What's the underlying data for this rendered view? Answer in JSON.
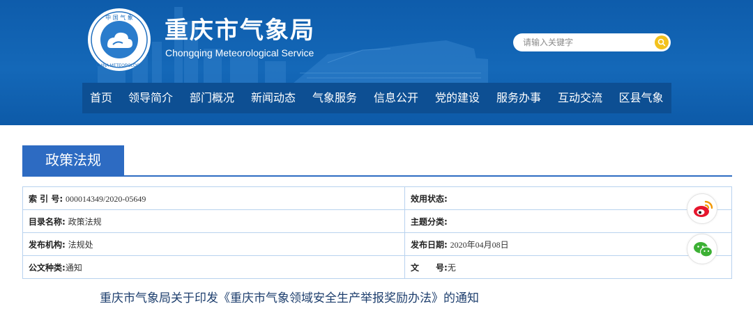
{
  "header": {
    "title": "重庆市气象局",
    "subtitle": "Chongqing Meteorological Service",
    "logo_text": "中国气象 CHINA METEOROLOGY",
    "search": {
      "placeholder": "请输入关键字"
    }
  },
  "nav": {
    "items": [
      {
        "label": "首页"
      },
      {
        "label": "领导简介"
      },
      {
        "label": "部门概况"
      },
      {
        "label": "新闻动态"
      },
      {
        "label": "气象服务"
      },
      {
        "label": "信息公开"
      },
      {
        "label": "党的建设"
      },
      {
        "label": "服务办事"
      },
      {
        "label": "互动交流"
      },
      {
        "label": "区县气象"
      }
    ]
  },
  "section": {
    "title": "政策法规"
  },
  "info": {
    "index_label": "索 引 号:",
    "index_value": "000014349/2020-05649",
    "status_label": "效用状态:",
    "status_value": "",
    "catalog_label": "目录名称:",
    "catalog_value": "政策法规",
    "topic_label": "主题分类:",
    "topic_value": "",
    "issuer_label": "发布机构:",
    "issuer_value": "法规处",
    "date_label": "发布日期:",
    "date_value": "2020年04月08日",
    "doctype_label": "公文种类:",
    "doctype_value": "通知",
    "docno_label": "文　　号:",
    "docno_value": "无"
  },
  "share": {
    "weibo_icon": "weibo-icon",
    "wechat_icon": "wechat-icon"
  },
  "article": {
    "title": "重庆市气象局关于印发《重庆市气象领域安全生产举报奖励办法》的通知"
  },
  "colors": {
    "header_bg": "#1468b8",
    "nav_bg": "#0d4f93",
    "section_accent": "#2d6bc2",
    "search_button": "#f3c21d",
    "weibo_red": "#e6162d",
    "wechat_green": "#3cb034"
  }
}
